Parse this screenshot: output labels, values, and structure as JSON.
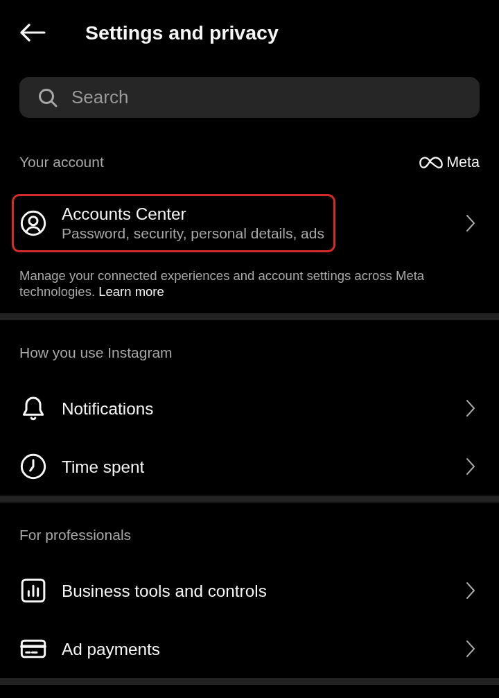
{
  "header": {
    "title": "Settings and privacy"
  },
  "search": {
    "placeholder": "Search"
  },
  "sections": [
    {
      "title": "Your account",
      "brand": "Meta",
      "items": [
        {
          "kind": "account",
          "label": "Accounts Center",
          "subtitle": "Password, security, personal details, ads",
          "highlighted": true
        }
      ],
      "note": {
        "text": "Manage your connected experiences and account settings across Meta technologies.",
        "link": "Learn more"
      }
    },
    {
      "title": "How you use Instagram",
      "items": [
        {
          "kind": "alerts",
          "label": "Notifications",
          "highlighted": false
        },
        {
          "kind": "time",
          "label": "Time spent",
          "highlighted": false
        }
      ]
    },
    {
      "title": "For professionals",
      "items": [
        {
          "kind": "business",
          "label": "Business tools and controls",
          "highlighted": false
        },
        {
          "kind": "payments",
          "label": "Ad payments",
          "highlighted": false
        }
      ]
    }
  ]
}
